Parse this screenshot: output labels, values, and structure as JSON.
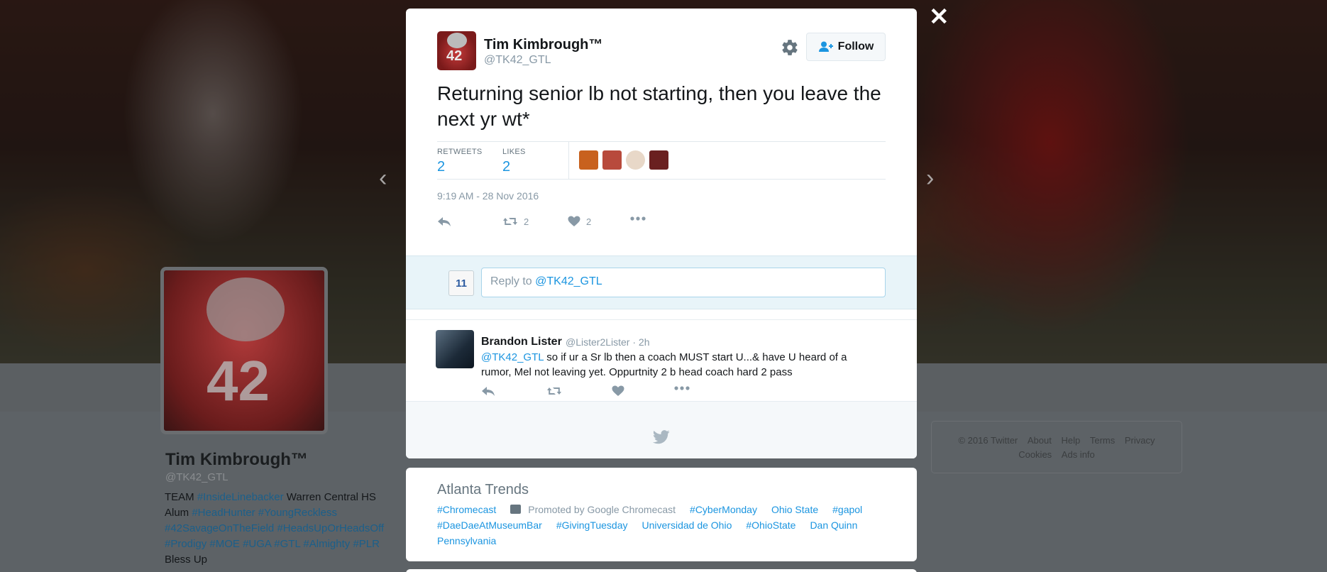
{
  "profile": {
    "name": "Tim Kimbrough™",
    "handle": "@TK42_GTL",
    "bio_parts": {
      "p1": "TEAM ",
      "p2": "#InsideLinebacker",
      "p3": " Warren Central HS Alum ",
      "p4": "#HeadHunter",
      "p5": "#YoungReckless",
      "p6": "#42SavageOnTheField",
      "p7": "#HeadsUpOrHeadsOff",
      "p8": "#Prodigy",
      "p9": "#MOE",
      "p10": "#UGA",
      "p11": "#GTL",
      "p12": "#Almighty",
      "p13": "#PLR",
      "p14": " Bless Up"
    }
  },
  "footer": {
    "copyright": "© 2016 Twitter",
    "about": "About",
    "help": "Help",
    "terms": "Terms",
    "privacy": "Privacy",
    "cookies": "Cookies",
    "ads_info": "Ads info"
  },
  "nav": {
    "prev": "‹",
    "next": "›",
    "close": "✕"
  },
  "tweet": {
    "author_name": "Tim Kimbrough™",
    "author_handle": "@TK42_GTL",
    "follow_label": "Follow",
    "text": "Returning senior lb not starting, then you leave the next yr wt*",
    "retweets_label": "RETWEETS",
    "retweets_count": "2",
    "likes_label": "LIKES",
    "likes_count": "2",
    "timestamp": "9:19 AM - 28 Nov 2016",
    "action_retweet_count": "2",
    "action_like_count": "2",
    "likers": [
      {
        "color": "#c8611e"
      },
      {
        "color": "#b84a3c"
      },
      {
        "color": "#e8d8c8"
      },
      {
        "color": "#6a2020"
      }
    ]
  },
  "reply_box": {
    "prefix": "Reply to ",
    "mention": "@TK42_GTL",
    "my_avatar_text": "11"
  },
  "reply_tweet": {
    "name": "Brandon Lister",
    "meta": "@Lister2Lister · 2h",
    "mention": "@TK42_GTL",
    "text": " so if ur a Sr lb then a coach MUST start U...& have U heard of a rumor, Mel not leaving yet. Oppurtnity 2 b head coach hard 2 pass"
  },
  "trends": {
    "title": "Atlanta Trends",
    "row1": {
      "t1": "#Chromecast",
      "promo": "Promoted by Google Chromecast",
      "t2": "#CyberMonday",
      "t3": "Ohio State",
      "t4": "#gapol"
    },
    "row2": {
      "t1": "#DaeDaeAtMuseumBar",
      "t2": "#GivingTuesday",
      "t3": "Universidad de Ohio",
      "t4": "#OhioState",
      "t5": "Dan Quinn"
    },
    "row3": {
      "t1": "Pennsylvania"
    }
  },
  "colors": {
    "link": "#1b95e0",
    "text": "#14171a",
    "muted": "#8899a6",
    "reply_bg": "#e8f4f9"
  }
}
